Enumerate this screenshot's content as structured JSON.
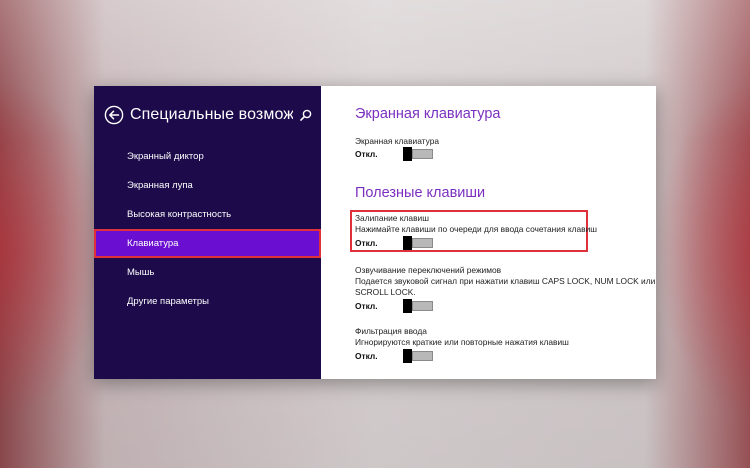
{
  "sidebar": {
    "title": "Специальные возможн...",
    "items": [
      {
        "label": "Экранный диктор"
      },
      {
        "label": "Экранная лупа"
      },
      {
        "label": "Высокая контрастность"
      },
      {
        "label": "Клавиатура"
      },
      {
        "label": "Мышь"
      },
      {
        "label": "Другие параметры"
      }
    ],
    "active_index": 3
  },
  "content": {
    "sections": [
      {
        "title": "Экранная клавиатура",
        "settings": [
          {
            "label": "Экранная клавиатура",
            "state": "Откл."
          }
        ]
      },
      {
        "title": "Полезные клавиши",
        "settings": [
          {
            "label": "Залипание клавиш",
            "description": "Нажимайте клавиши по очереди для ввода сочетания клавиш",
            "state": "Откл."
          },
          {
            "label": "Озвучивание переключений режимов",
            "description_line1": "Подается звуковой сигнал при нажатии клавиш CAPS LOCK, NUM LOCK или",
            "description_line2": "SCROLL LOCK.",
            "state": "Откл."
          },
          {
            "label": "Фильтрация ввода",
            "description": "Игнорируются краткие или повторные нажатия клавиш",
            "state": "Откл."
          }
        ]
      }
    ]
  },
  "colors": {
    "sidebar_bg": "#1c0a4a",
    "active_item": "#6a0fd1",
    "accent_title": "#7b2fbf",
    "highlight_border": "#e0303a"
  }
}
